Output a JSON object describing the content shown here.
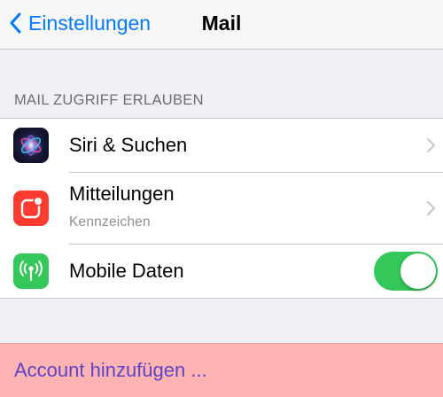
{
  "navbar": {
    "back_label": "Einstellungen",
    "title": "Mail"
  },
  "section": {
    "header": "MAIL ZUGRIFF ERLAUBEN",
    "rows": [
      {
        "label": "Siri & Suchen",
        "icon": "siri-icon",
        "accessory": "chevron"
      },
      {
        "label": "Mitteilungen",
        "sublabel": "Kennzeichen",
        "icon": "notifications-icon",
        "accessory": "chevron"
      },
      {
        "label": "Mobile Daten",
        "icon": "cellular-antenna-icon",
        "accessory": "toggle",
        "toggle_on": true
      }
    ]
  },
  "add_account": {
    "label": "Account hinzufügen ..."
  },
  "colors": {
    "accent": "#007aff",
    "toggle_on": "#34c759",
    "notifications": "#ff3b30",
    "add_account_bg": "#ffb3b3",
    "add_account_text": "#5a44c8"
  }
}
